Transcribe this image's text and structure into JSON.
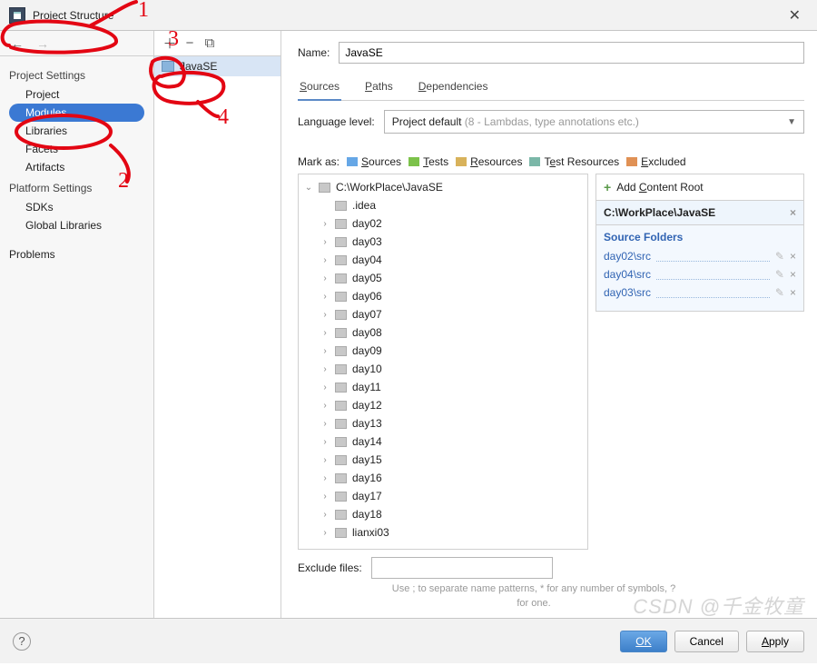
{
  "title": "Project Structure",
  "sidebar": {
    "sections": [
      {
        "label": "Project Settings",
        "items": [
          "Project",
          "Modules",
          "Libraries",
          "Facets",
          "Artifacts"
        ],
        "selected": 1
      },
      {
        "label": "Platform Settings",
        "items": [
          "SDKs",
          "Global Libraries"
        ]
      },
      {
        "label": "",
        "items": [
          "Problems"
        ]
      }
    ]
  },
  "module_list": {
    "items": [
      "JavaSE"
    ],
    "selected": 0
  },
  "main": {
    "name_label": "Name:",
    "name_value": "JavaSE",
    "tabs": [
      {
        "label": "Sources",
        "u": "S",
        "active": true
      },
      {
        "label": "Paths",
        "u": "P",
        "active": false
      },
      {
        "label": "Dependencies",
        "u": "D",
        "active": false
      }
    ],
    "lang_label": "Language level:",
    "lang_value_prefix": "Project default ",
    "lang_value_hint": "(8 - Lambdas, type annotations etc.)",
    "mark_label": "Mark as:",
    "marks": [
      {
        "label": "Sources",
        "u": "S",
        "color": "c-blue"
      },
      {
        "label": "Tests",
        "u": "T",
        "color": "c-green"
      },
      {
        "label": "Resources",
        "u": "R",
        "color": "c-gold"
      },
      {
        "label": "Test Resources",
        "u": "",
        "lead": "T",
        "color": "c-teal"
      },
      {
        "label": "Excluded",
        "u": "E",
        "color": "c-orange"
      }
    ],
    "tree_root": "C:\\WorkPlace\\JavaSE",
    "tree_children": [
      ".idea",
      "day02",
      "day03",
      "day04",
      "day05",
      "day06",
      "day07",
      "day08",
      "day09",
      "day10",
      "day11",
      "day12",
      "day13",
      "day14",
      "day15",
      "day16",
      "day17",
      "day18",
      "lianxi03"
    ],
    "right": {
      "add_label": "Add Content Root",
      "root_path": "C:\\WorkPlace\\JavaSE",
      "src_title": "Source Folders",
      "src_items": [
        "day02\\src",
        "day04\\src",
        "day03\\src"
      ]
    },
    "exclude_label": "Exclude files:",
    "exclude_hint": "Use ; to separate name patterns, * for any number of symbols, ? for one."
  },
  "footer": {
    "ok": "OK",
    "cancel": "Cancel",
    "apply": "Apply"
  },
  "annotations": {
    "n1": "1",
    "n2": "2",
    "n3": "3",
    "n4": "4"
  },
  "watermark": "CSDN @千金牧童"
}
